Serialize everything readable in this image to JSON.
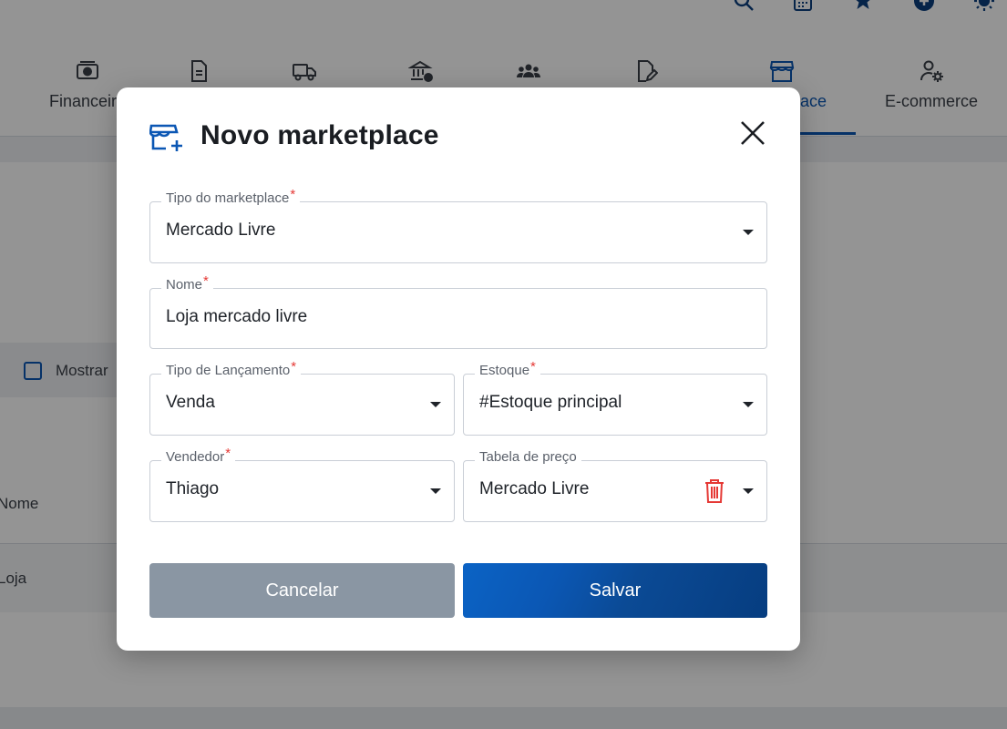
{
  "nav": {
    "items": [
      {
        "label": "Financeiro",
        "icon": "cash-icon"
      },
      {
        "label": "",
        "icon": "document-icon"
      },
      {
        "label": "",
        "icon": "truck-icon"
      },
      {
        "label": "",
        "icon": "bank-icon"
      },
      {
        "label": "",
        "icon": "people-icon"
      },
      {
        "label": "",
        "icon": "edit-document-icon"
      },
      {
        "label": "Marketplace",
        "icon": "store-icon"
      },
      {
        "label": "E-commerce",
        "icon": "user-settings-icon"
      }
    ]
  },
  "background": {
    "filter_label": "Mostrar",
    "table_header": "Nome",
    "table_row": "Loja"
  },
  "modal": {
    "title": "Novo marketplace",
    "fields": {
      "tipo_marketplace": {
        "label": "Tipo do marketplace",
        "value": "Mercado Livre"
      },
      "nome": {
        "label": "Nome",
        "value": "Loja mercado livre"
      },
      "tipo_lancamento": {
        "label": "Tipo de Lançamento",
        "value": "Venda"
      },
      "estoque": {
        "label": "Estoque",
        "value": "#Estoque principal"
      },
      "vendedor": {
        "label": "Vendedor",
        "value": "Thiago"
      },
      "tabela_preco": {
        "label": "Tabela de preço",
        "value": "Mercado Livre"
      }
    },
    "required_mark": "*",
    "cancel_label": "Cancelar",
    "save_label": "Salvar"
  },
  "colors": {
    "brand": "#0b57b4",
    "danger": "#e53935",
    "cancel": "#8a96a3"
  }
}
